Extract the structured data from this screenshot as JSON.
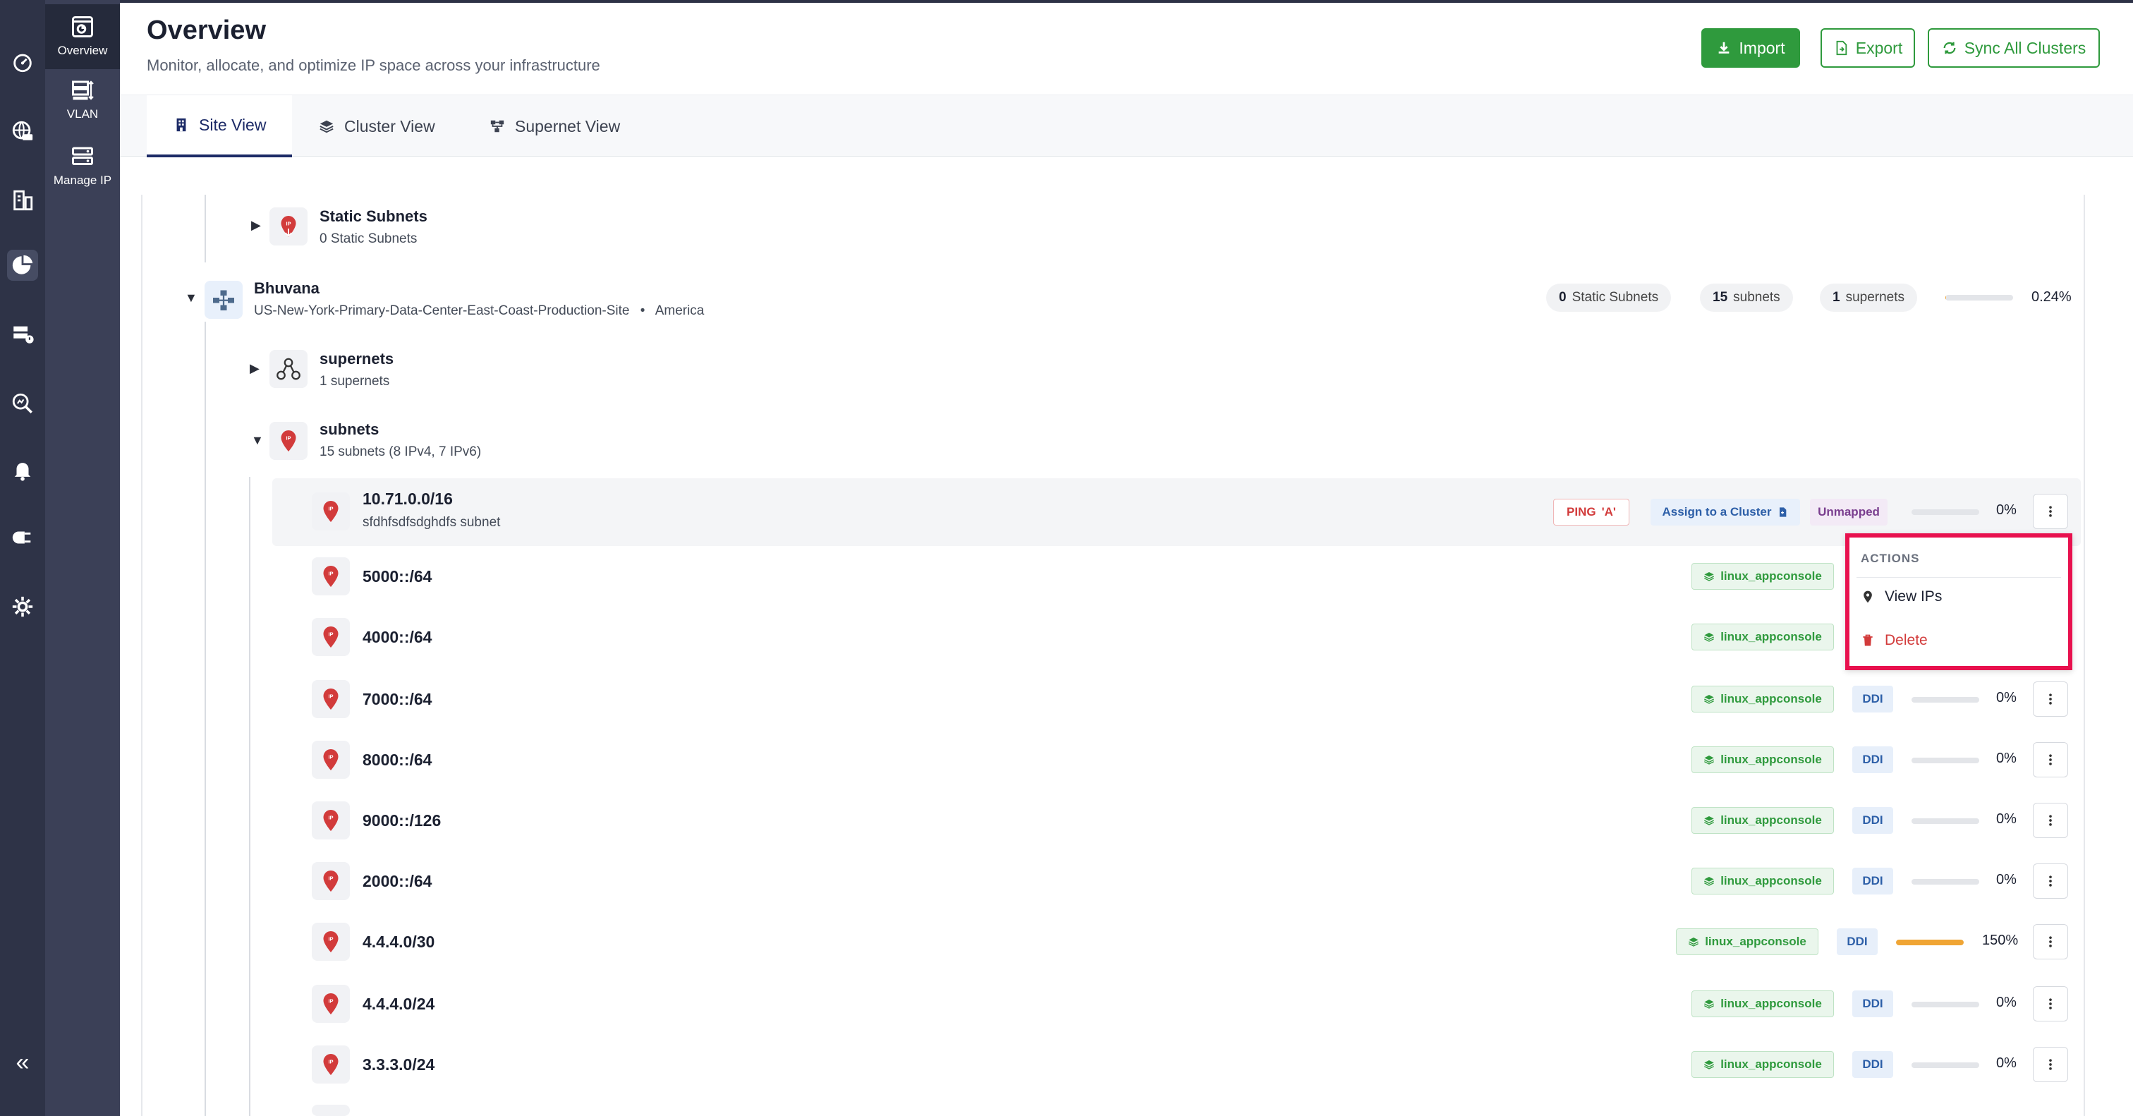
{
  "header": {
    "title": "Overview",
    "subtitle": "Monitor, allocate, and optimize IP space across your infrastructure",
    "import_label": "Import",
    "export_label": "Export",
    "sync_label": "Sync All Clusters"
  },
  "subnav": {
    "items": [
      {
        "label": "Overview",
        "icon": "overview-icon"
      },
      {
        "label": "VLAN",
        "icon": "vlan-icon"
      },
      {
        "label": "Manage IP",
        "icon": "manage-ip-icon"
      }
    ],
    "collapse_glyph": "«"
  },
  "tabs": [
    {
      "label": "Site View",
      "icon": "building-icon"
    },
    {
      "label": "Cluster View",
      "icon": "layers-icon"
    },
    {
      "label": "Supernet View",
      "icon": "hierarchy-icon"
    }
  ],
  "tree": {
    "static_group": {
      "title": "Static Subnets",
      "sub": "0 Static Subnets"
    },
    "site": {
      "name": "Bhuvana",
      "location": "US-New-York-Primary-Data-Center-East-Coast-Production-Site",
      "separator": "•",
      "region": "America",
      "static_count": "0",
      "static_label": "Static Subnets",
      "subnet_count": "15",
      "subnet_label": "subnets",
      "supernet_count": "1",
      "supernet_label": "supernets",
      "utilization": 0.0024,
      "utilization_label": "0.24%"
    },
    "supernets_group": {
      "title": "supernets",
      "sub": "1 supernets"
    },
    "subnets_group": {
      "title": "subnets",
      "sub": "15 subnets (8 IPv4, 7 IPv6)"
    }
  },
  "subnets": [
    {
      "cidr": "10.71.0.0/16",
      "desc": "sfdhfsdfsdghdfs subnet",
      "ping": "PING",
      "ping_mark": "'A'",
      "assign": "Assign to a Cluster",
      "status": "Unmapped",
      "util": 0,
      "pct": "0%"
    },
    {
      "cidr": "5000::/64",
      "cluster": "linux_appconsole"
    },
    {
      "cidr": "4000::/64",
      "cluster": "linux_appconsole"
    },
    {
      "cidr": "7000::/64",
      "cluster": "linux_appconsole",
      "ddi": "DDI",
      "util": 0,
      "pct": "0%"
    },
    {
      "cidr": "8000::/64",
      "cluster": "linux_appconsole",
      "ddi": "DDI",
      "util": 0,
      "pct": "0%"
    },
    {
      "cidr": "9000::/126",
      "cluster": "linux_appconsole",
      "ddi": "DDI",
      "util": 0,
      "pct": "0%"
    },
    {
      "cidr": "2000::/64",
      "cluster": "linux_appconsole",
      "ddi": "DDI",
      "util": 0,
      "pct": "0%"
    },
    {
      "cidr": "4.4.4.0/30",
      "cluster": "linux_appconsole",
      "ddi": "DDI",
      "util": 1.5,
      "pct": "150%"
    },
    {
      "cidr": "4.4.4.0/24",
      "cluster": "linux_appconsole",
      "ddi": "DDI",
      "util": 0,
      "pct": "0%"
    },
    {
      "cidr": "3.3.3.0/24",
      "cluster": "linux_appconsole",
      "ddi": "DDI",
      "util": 0,
      "pct": "0%"
    }
  ],
  "actions_menu": {
    "header": "ACTIONS",
    "view_label": "View IPs",
    "delete_label": "Delete"
  },
  "colors": {
    "rail": "#2e3347",
    "subnav": "#3b4057",
    "primary_green": "#2f9a3d",
    "active_tab": "#1c2a66",
    "danger": "#d23b3b",
    "highlight_border": "#e8114e",
    "utilization_bar": "#f0a534"
  }
}
